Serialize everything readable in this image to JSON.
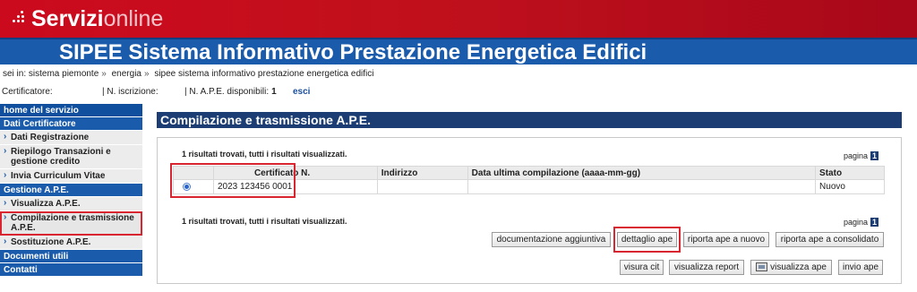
{
  "brand": {
    "name_bold": "Servizi",
    "name_light": "online"
  },
  "app_title": "SIPEE Sistema Informativo Prestazione Energetica Edifici",
  "breadcrumb": {
    "prefix": "sei in:",
    "items": [
      "sistema piemonte",
      "energia",
      "sipee sistema informativo prestazione energetica edifici"
    ],
    "separator": "»"
  },
  "info_bar": {
    "certificatore_label": "Certificatore:",
    "iscrizione_label": "| N. iscrizione:",
    "ape_label": "| N. A.P.E. disponibili:",
    "ape_value": "1",
    "exit_label": "esci"
  },
  "sidebar": {
    "home": "home del servizio",
    "sections": [
      {
        "title": "Dati Certificatore",
        "items": [
          "Dati Registrazione",
          "Riepilogo Transazioni e gestione credito",
          "Invia Curriculum Vitae"
        ]
      },
      {
        "title": "Gestione A.P.E.",
        "items": [
          "Visualizza A.P.E.",
          "Compilazione e trasmissione A.P.E.",
          "Sostituzione A.P.E."
        ]
      }
    ],
    "footer_items": [
      "Documenti utili",
      "Contatti"
    ]
  },
  "main": {
    "section_title": "Compilazione e trasmissione A.P.E.",
    "result_text": "1 risultati trovati, tutti i risultati visualizzati.",
    "page_label": "pagina",
    "page_number": "1",
    "table": {
      "headers": [
        "",
        "Certificato N.",
        "Indirizzo",
        "Data ultima compilazione (aaaa-mm-gg)",
        "Stato"
      ],
      "rows": [
        {
          "selected": true,
          "cells": [
            "",
            "2023 123456 0001",
            "",
            "",
            "Nuovo"
          ]
        }
      ]
    },
    "buttons_row1": [
      "documentazione aggiuntiva",
      "dettaglio ape",
      "riporta ape a nuovo",
      "riporta ape a consolidato"
    ],
    "buttons_row2": [
      "visura cit",
      "visualizza report",
      "visualizza ape",
      "invio ape"
    ]
  },
  "colors": {
    "brand_red": "#cc0a1e",
    "header_blue": "#1b5bab",
    "section_navy": "#1b3d73",
    "highlight_red": "#d9252f"
  }
}
